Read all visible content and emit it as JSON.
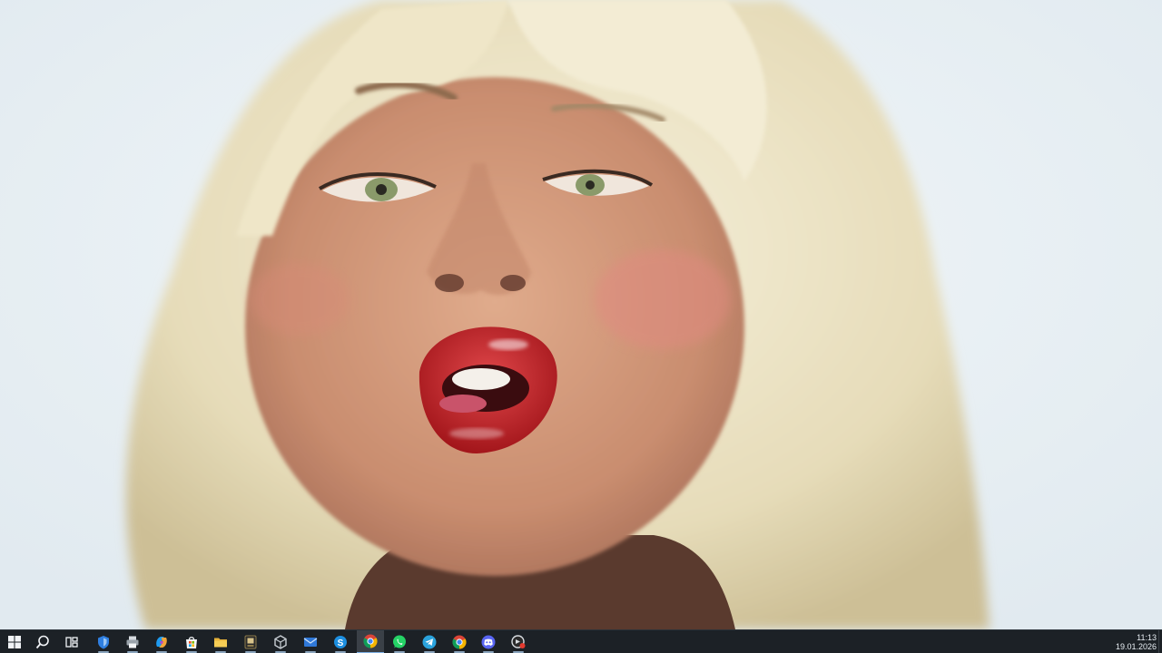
{
  "desktop": {
    "wallpaper": "photo-portrait",
    "colors": {
      "background": "#e9f0f4",
      "hair": "#ece3c6",
      "skin": "#d59a7e",
      "lips": "#c21d22",
      "eyes": "#8a9a6a"
    }
  },
  "taskbar": {
    "colors": {
      "background": "#1c2126",
      "active": "#3a4047",
      "indicator": "#7fb3e8"
    },
    "items": [
      {
        "name": "start-button",
        "icon": "windows-logo-icon"
      },
      {
        "name": "search-button",
        "icon": "search-icon"
      },
      {
        "name": "task-view-button",
        "icon": "task-view-icon"
      },
      {
        "name": "taskbar-app-shield",
        "icon": "shield-icon"
      },
      {
        "name": "taskbar-app-printer",
        "icon": "printer-icon"
      },
      {
        "name": "taskbar-app-copilot",
        "icon": "copilot-icon"
      },
      {
        "name": "taskbar-app-store",
        "icon": "store-icon"
      },
      {
        "name": "taskbar-app-file-explorer",
        "icon": "folder-icon"
      },
      {
        "name": "taskbar-app-game",
        "icon": "game-icon"
      },
      {
        "name": "taskbar-app-unity",
        "icon": "unity-icon"
      },
      {
        "name": "taskbar-app-mail",
        "icon": "mail-icon"
      },
      {
        "name": "taskbar-app-skype",
        "icon": "skype-icon"
      },
      {
        "name": "taskbar-app-chrome-active",
        "icon": "chrome-icon",
        "state": "active"
      },
      {
        "name": "taskbar-app-whatsapp",
        "icon": "whatsapp-icon"
      },
      {
        "name": "taskbar-app-telegram",
        "icon": "telegram-icon"
      },
      {
        "name": "taskbar-app-chrome",
        "icon": "chrome-icon"
      },
      {
        "name": "taskbar-app-discord",
        "icon": "discord-icon"
      },
      {
        "name": "taskbar-app-recorder",
        "icon": "recorder-icon"
      }
    ],
    "clock": {
      "time": "11:13",
      "date": "19.01.2026"
    }
  }
}
